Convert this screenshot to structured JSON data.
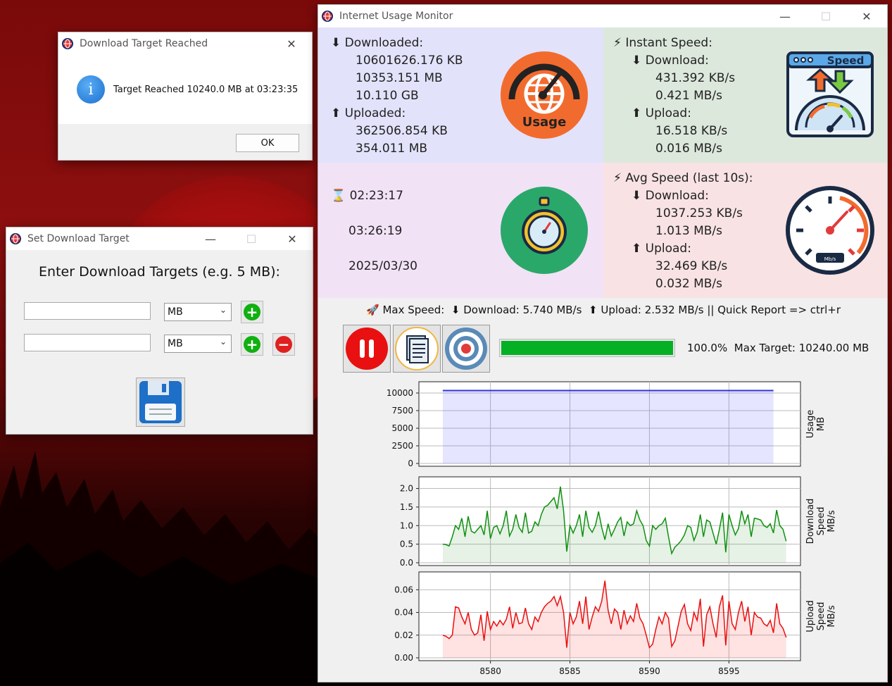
{
  "dialog_target_reached": {
    "title": "Download Target Reached",
    "message": "Target Reached 10240.0 MB at 03:23:35",
    "ok_label": "OK"
  },
  "set_target_window": {
    "title": "Set Download Target",
    "heading": "Enter Download Targets (e.g. 5 MB):",
    "rows": [
      {
        "value": "",
        "unit": "MB"
      },
      {
        "value": "",
        "unit": "MB"
      }
    ]
  },
  "main_window": {
    "title": "Internet Usage Monitor",
    "usage": {
      "downloaded_label": "Downloaded:",
      "downloaded_kb": "10601626.176 KB",
      "downloaded_mb": "10353.151 MB",
      "downloaded_gb": "10.110 GB",
      "uploaded_label": "Uploaded:",
      "uploaded_kb": "362506.854 KB",
      "uploaded_mb": "354.011 MB",
      "icon_text": "Usage"
    },
    "instant": {
      "label": "Instant Speed:",
      "download_label": "Download:",
      "download_kbs": "431.392 KB/s",
      "download_mbs": "0.421 MB/s",
      "upload_label": "Upload:",
      "upload_kbs": "16.518 KB/s",
      "upload_mbs": "0.016 MB/s",
      "icon_text": "Speed"
    },
    "time": {
      "elapsed": "02:23:17",
      "clock": "03:26:19",
      "date": "2025/03/30"
    },
    "avg": {
      "label": "Avg Speed (last 10s):",
      "download_label": "Download:",
      "download_kbs": "1037.253 KB/s",
      "download_mbs": "1.013 MB/s",
      "upload_label": "Upload:",
      "upload_kbs": "32.469 KB/s",
      "upload_mbs": "0.032 MB/s",
      "gauge_unit": "Mb/s"
    },
    "max_speed_text": "Max Speed:",
    "max_download_text": "Download: 5.740 MB/s",
    "max_upload_text": "Upload: 2.532 MB/s",
    "quick_report_text": "||  Quick Report => ctrl+r",
    "progress_percent": 100.0,
    "progress_text": "100.0%",
    "max_target_text": "Max Target: 10240.00 MB"
  },
  "colors": {
    "usage_bg": "#e2e2fb",
    "instant_bg": "#dde8dd",
    "time_bg": "#f2e2f6",
    "avg_bg": "#f8e2e4",
    "progress": "#06b025",
    "usage_line": "#3333dd",
    "download_line": "#109010",
    "upload_line": "#e81010"
  },
  "chart_data": [
    {
      "type": "area",
      "ylabel": "Usage\nMB",
      "yticks": [
        "0",
        "2500",
        "5000",
        "7500",
        "10000"
      ],
      "ylim": [
        0,
        11000
      ],
      "xlim": [
        8575.5,
        8599.5
      ],
      "x": [
        8577,
        8597.8
      ],
      "values": [
        10353,
        10353
      ],
      "grid": true
    },
    {
      "type": "area",
      "ylabel": "Download\nSpeed\nMB/s",
      "yticks": [
        "0.0",
        "0.5",
        "1.0",
        "1.5",
        "2.0"
      ],
      "ylim": [
        0,
        2.2
      ],
      "xlim": [
        8575.5,
        8599.5
      ],
      "x_start": 8577,
      "x_step": 0.2,
      "values": [
        0.5,
        0.49,
        0.45,
        0.7,
        1.0,
        0.9,
        1.2,
        0.7,
        1.25,
        0.85,
        0.8,
        0.9,
        1.0,
        0.75,
        1.4,
        0.65,
        0.95,
        1.0,
        0.78,
        1.0,
        1.4,
        0.72,
        0.9,
        1.3,
        0.95,
        0.82,
        1.35,
        0.8,
        0.85,
        1.1,
        1.0,
        1.3,
        1.5,
        1.55,
        1.65,
        1.75,
        1.45,
        2.05,
        1.4,
        0.3,
        1.0,
        0.8,
        1.0,
        1.3,
        0.7,
        1.4,
        0.95,
        0.82,
        1.0,
        1.38,
        0.95,
        0.62,
        1.05,
        0.72,
        0.9,
        1.1,
        1.22,
        0.72,
        1.1,
        1.0,
        1.05,
        1.4,
        1.15,
        1.0,
        0.6,
        0.45,
        1.0,
        0.9,
        1.0,
        1.05,
        1.2,
        0.7,
        0.25,
        0.42,
        0.5,
        0.6,
        0.75,
        1.0,
        0.95,
        0.6,
        0.82,
        1.3,
        0.7,
        1.15,
        1.1,
        0.8,
        0.5,
        0.9,
        1.35,
        0.28,
        1.3,
        1.0,
        0.75,
        0.92,
        1.4,
        1.05,
        1.3,
        0.7,
        1.2,
        1.18,
        1.15,
        1.0,
        0.95,
        1.05,
        0.8,
        1.42,
        1.0,
        0.9,
        0.58
      ],
      "grid": true
    },
    {
      "type": "area",
      "ylabel": "Upload\nSpeed\nMB/s",
      "yticks": [
        "0.00",
        "0.02",
        "0.04",
        "0.06"
      ],
      "ylim": [
        0,
        0.072
      ],
      "xlim": [
        8575.5,
        8599.5
      ],
      "x_start": 8577,
      "x_step": 0.2,
      "values": [
        0.02,
        0.019,
        0.017,
        0.02,
        0.045,
        0.044,
        0.036,
        0.03,
        0.04,
        0.025,
        0.02,
        0.022,
        0.038,
        0.015,
        0.041,
        0.025,
        0.032,
        0.028,
        0.033,
        0.029,
        0.034,
        0.045,
        0.026,
        0.04,
        0.03,
        0.031,
        0.044,
        0.03,
        0.025,
        0.036,
        0.032,
        0.04,
        0.045,
        0.048,
        0.05,
        0.054,
        0.046,
        0.054,
        0.04,
        0.009,
        0.04,
        0.03,
        0.036,
        0.05,
        0.03,
        0.054,
        0.025,
        0.036,
        0.045,
        0.041,
        0.05,
        0.068,
        0.042,
        0.03,
        0.043,
        0.04,
        0.025,
        0.042,
        0.03,
        0.037,
        0.032,
        0.048,
        0.035,
        0.03,
        0.02,
        0.009,
        0.012,
        0.025,
        0.036,
        0.03,
        0.04,
        0.035,
        0.01,
        0.015,
        0.028,
        0.041,
        0.047,
        0.03,
        0.024,
        0.04,
        0.033,
        0.052,
        0.01,
        0.038,
        0.045,
        0.03,
        0.018,
        0.045,
        0.055,
        0.011,
        0.05,
        0.03,
        0.025,
        0.04,
        0.05,
        0.032,
        0.045,
        0.02,
        0.04,
        0.036,
        0.035,
        0.03,
        0.028,
        0.033,
        0.022,
        0.048,
        0.03,
        0.026,
        0.018
      ],
      "grid": true
    }
  ],
  "x_ticks": [
    "8580",
    "8585",
    "8590",
    "8595"
  ]
}
